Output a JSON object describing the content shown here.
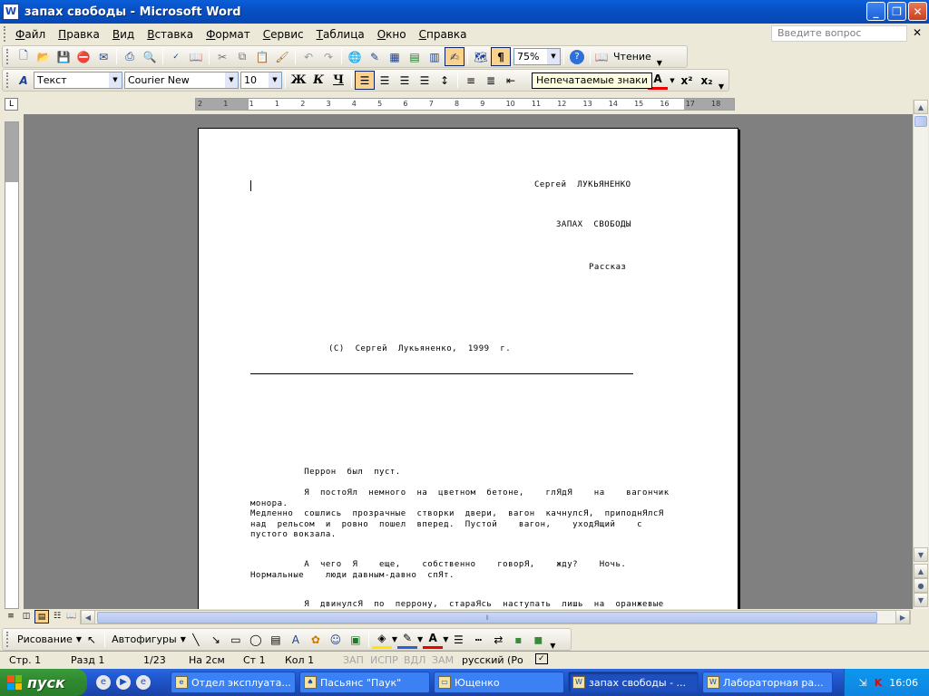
{
  "window": {
    "title": "запах свободы - Microsoft Word",
    "app_icon": "word-icon"
  },
  "menu": {
    "items": [
      "Файл",
      "Правка",
      "Вид",
      "Вставка",
      "Формат",
      "Сервис",
      "Таблица",
      "Окно",
      "Справка"
    ],
    "ask_placeholder": "Введите вопрос"
  },
  "toolbar_standard": {
    "zoom": "75%",
    "reading_label": "Чтение"
  },
  "toolbar_format": {
    "style": "Текст",
    "font": "Courier New",
    "size": "10",
    "bold": "Ж",
    "italic": "К",
    "underline": "Ч"
  },
  "tooltip": "Непечатаемые знаки",
  "ruler": {
    "numbers": [
      "2",
      "1",
      "1",
      "1",
      "2",
      "3",
      "4",
      "5",
      "6",
      "7",
      "8",
      "9",
      "10",
      "11",
      "12",
      "13",
      "14",
      "15",
      "16",
      "17",
      "18"
    ]
  },
  "document": {
    "author": "Сергей  ЛУКЬЯНЕНКО",
    "title": "ЗАПАХ  СВОБОДЫ",
    "genre": "Рассказ",
    "copyright": "(С)  Сергей  Лукьяненко,  1999  г.",
    "paragraphs": [
      "          Перрон  был  пуст.",
      "          Я  постоЯл  немного  на  цветном  бетоне,    глЯдЯ    на    вагончик монора.",
      "Медленно  сошлись  прозрачные  створки  двери,  вагон  качнулсЯ,  приподнЯлсЯ над  рельсом  и  ровно  пошел  вперед.  Пустой    вагон,    уходЯщий    с пустого вокзала.",
      "          А  чего  Я    еще,    собственно    говорЯ,    жду?    Ночь. Нормальные    люди давным-давно  спЯт.",
      "          Я  двинулсЯ  по  перрону,  стараЯсь  наступать  лишь  на  оранжевые"
    ]
  },
  "drawing_toolbar": {
    "draw_label": "Рисование",
    "autoshapes_label": "Автофигуры"
  },
  "status": {
    "page": "Стр.  1",
    "section": "Разд  1",
    "pages": "1/23",
    "at": "На  2см",
    "line": "Ст  1",
    "col": "Кол  1",
    "rec": "ЗАП",
    "trk": "ИСПР",
    "ext": "ВДЛ",
    "ovr": "ЗАМ",
    "language": "русский (Ро"
  },
  "taskbar": {
    "start_label": "пуск",
    "tasks": [
      "Отдел эксплуата...",
      "Пасьянс \"Паук\"",
      "Ющенко",
      "запах свободы - ...",
      "Лабораторная ра..."
    ],
    "clock": "16:06"
  }
}
